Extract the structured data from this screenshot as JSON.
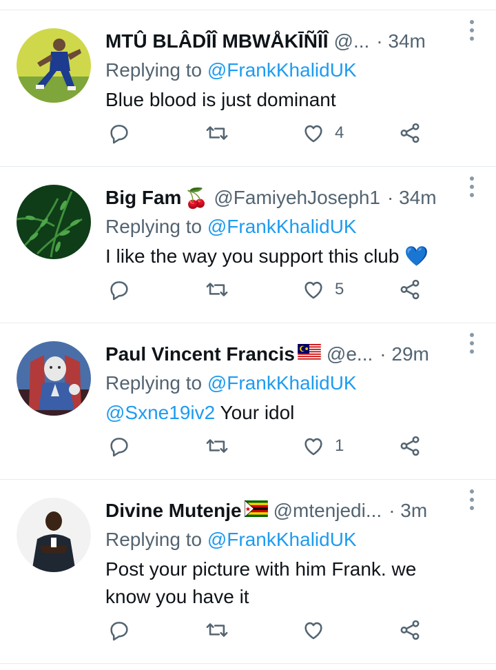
{
  "replying_label": "Replying to",
  "colors": {
    "accent": "#1d9bf0",
    "secondary": "#536471",
    "icon": "#536471",
    "divider": "#e6ecf0"
  },
  "tweets": [
    {
      "name": "MTÛ BLÂDÎÎ MBWÅKĪÑÎÎ",
      "emoji": "",
      "handle": "@...",
      "time": "· 34m",
      "replying_to": "@FrankKhalidUK",
      "text_mention": "",
      "text": "Blue blood is just dominant",
      "likes": "4"
    },
    {
      "name": "Big Fam",
      "emoji": "🍒",
      "handle": "@FamiyehJoseph1",
      "time": "· 34m",
      "replying_to": "@FrankKhalidUK",
      "text_mention": "",
      "text": "I like the way you support this club 💙",
      "likes": "5"
    },
    {
      "name": "Paul Vincent Francis",
      "emoji": "",
      "handle": "@e...",
      "time": "· 29m",
      "replying_to": "@FrankKhalidUK",
      "text_mention": "@Sxne19iv2",
      "text": " Your idol",
      "likes": "1"
    },
    {
      "name": "Divine Mutenje",
      "emoji": "",
      "handle": "@mtenjedi...",
      "time": "· 3m",
      "replying_to": "@FrankKhalidUK",
      "text_mention": "",
      "text": "Post your picture with him Frank. we know you have it",
      "likes": ""
    }
  ]
}
